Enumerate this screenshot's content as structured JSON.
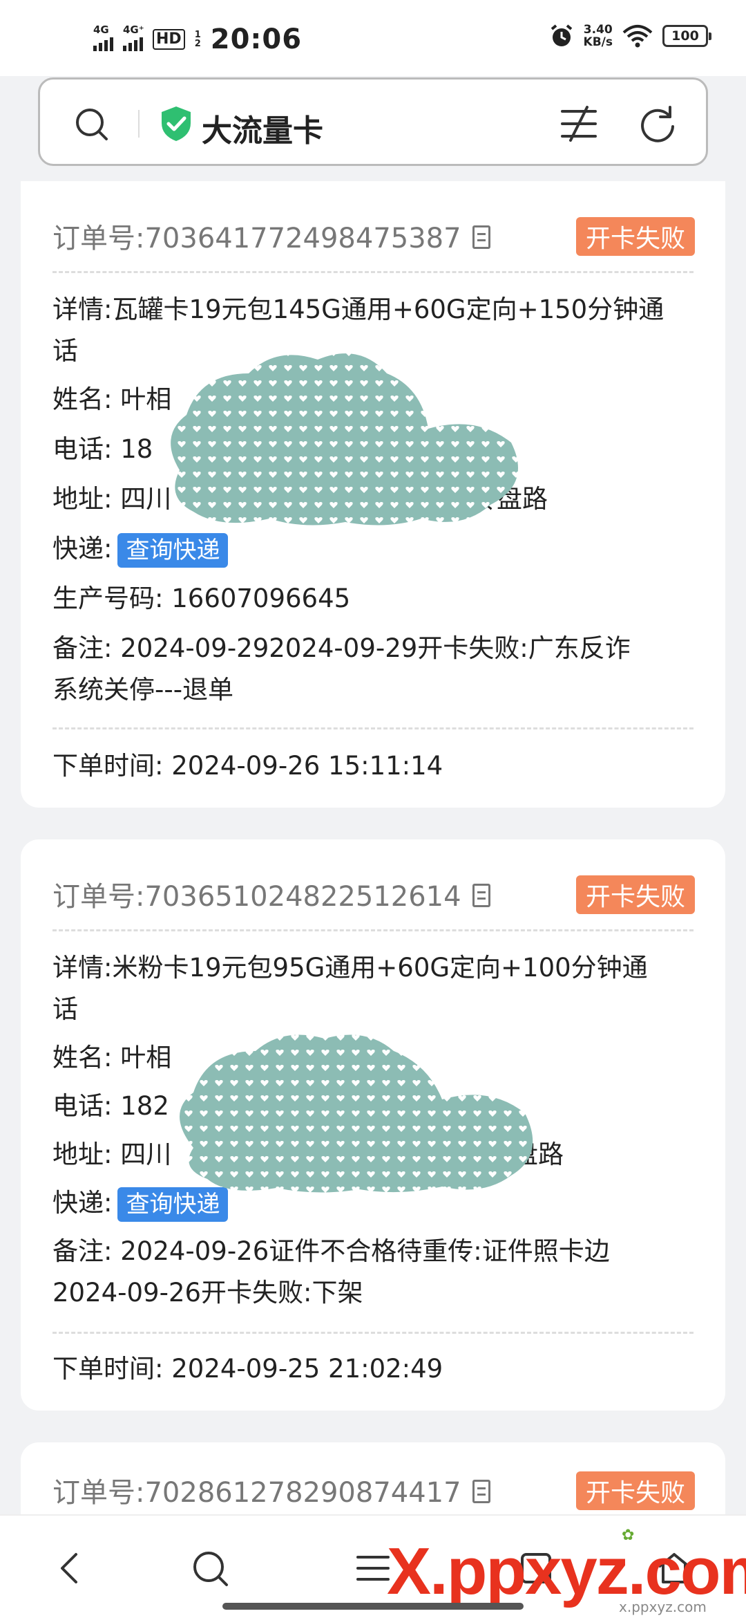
{
  "status_bar": {
    "signal1_label": "4G",
    "signal2_label": "4G⁺",
    "hd_label": "HD",
    "hd_nums": [
      "1",
      "2"
    ],
    "time": "20:06",
    "speed_value": "3.40",
    "speed_unit": "KB/s",
    "battery": "100"
  },
  "search_bar": {
    "title": "大流量卡"
  },
  "orders": [
    {
      "order_label": "订单号:",
      "order_no": "703641772498475387",
      "status": "开卡失败",
      "details_label": "详情:",
      "details": "瓦罐卡19元包145G通用+60G定向+150分钟通",
      "details_wrap": "话",
      "name_label": "姓名:",
      "name": "叶相",
      "phone_label": "电话:",
      "phone": "18",
      "address_label": "地址:",
      "address_start": "四川",
      "address_end": "砖盘路",
      "express_label": "快递:",
      "express_button": "查询快递",
      "prod_label": "生产号码:",
      "prod_no": "16607096645",
      "remark_label": "备注:",
      "remark": "2024-09-292024-09-29开卡失败:广东反诈",
      "remark_wrap": "系统关停---退单",
      "time_label": "下单时间:",
      "time": "2024-09-26 15:11:14"
    },
    {
      "order_label": "订单号:",
      "order_no": "703651024822512614",
      "status": "开卡失败",
      "details_label": "详情:",
      "details": "米粉卡19元包95G通用+60G定向+100分钟通",
      "details_wrap": "话",
      "name_label": "姓名:",
      "name": "叶相",
      "phone_label": "电话:",
      "phone": "182",
      "address_label": "地址:",
      "address_start": "四川",
      "address_end": "盘路",
      "express_label": "快递:",
      "express_button": "查询快递",
      "remark_label": "备注:",
      "remark": "2024-09-26证件不合格待重传:证件照卡边",
      "remark_wrap": "2024-09-26开卡失败:下架",
      "time_label": "下单时间:",
      "time": "2024-09-25 21:02:49"
    },
    {
      "order_label": "订单号:",
      "order_no": "702861278290874417",
      "status": "开卡失败"
    }
  ],
  "watermark": {
    "main": "X.ppxyz.com",
    "sub": "x.ppxyz.com"
  },
  "colors": {
    "badge": "#f4875a",
    "express_button": "#3a89e8",
    "shield": "#2fbf71",
    "redaction": "#8cbcb4"
  }
}
